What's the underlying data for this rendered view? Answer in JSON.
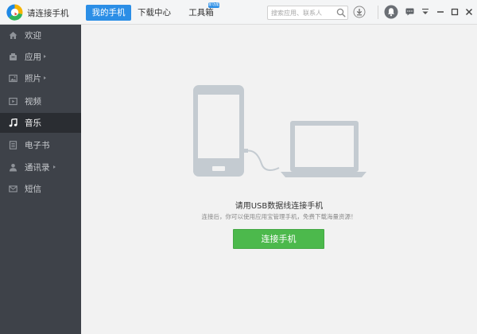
{
  "app": {
    "title": "请连接手机"
  },
  "tabs": [
    {
      "label": "我的手机",
      "active": true
    },
    {
      "label": "下载中心",
      "active": false
    },
    {
      "label": "工具箱",
      "active": false,
      "badge": "新功能"
    }
  ],
  "search": {
    "placeholder": "搜索应用、联系人"
  },
  "toolbar_icons": [
    "search-icon",
    "download-icon",
    "bell-icon",
    "message-icon",
    "menu-icon",
    "minimize-icon",
    "maximize-icon",
    "close-icon"
  ],
  "sidebar": {
    "items": [
      {
        "label": "欢迎",
        "icon": "home-icon",
        "has_arrow": false,
        "active": false
      },
      {
        "label": "应用",
        "icon": "apps-icon",
        "has_arrow": true,
        "active": false
      },
      {
        "label": "照片",
        "icon": "photo-icon",
        "has_arrow": true,
        "active": false
      },
      {
        "label": "视频",
        "icon": "video-icon",
        "has_arrow": false,
        "active": false
      },
      {
        "label": "音乐",
        "icon": "music-icon",
        "has_arrow": false,
        "active": true
      },
      {
        "label": "电子书",
        "icon": "ebook-icon",
        "has_arrow": false,
        "active": false
      },
      {
        "label": "通讯录",
        "icon": "contacts-icon",
        "has_arrow": true,
        "active": false
      },
      {
        "label": "短信",
        "icon": "sms-icon",
        "has_arrow": false,
        "active": false
      }
    ]
  },
  "main": {
    "headline": "请用USB数据线连接手机",
    "subline": "连接后，你可以使用应用宝管理手机，免费下载海量资源！",
    "connect_button": "连接手机"
  },
  "colors": {
    "accent": "#2b8ee6",
    "sidebar_bg": "#3e4249",
    "sidebar_active_bg": "#2a2d32",
    "button_green": "#4cb94c",
    "illustration_gray": "#c4cbd1"
  }
}
